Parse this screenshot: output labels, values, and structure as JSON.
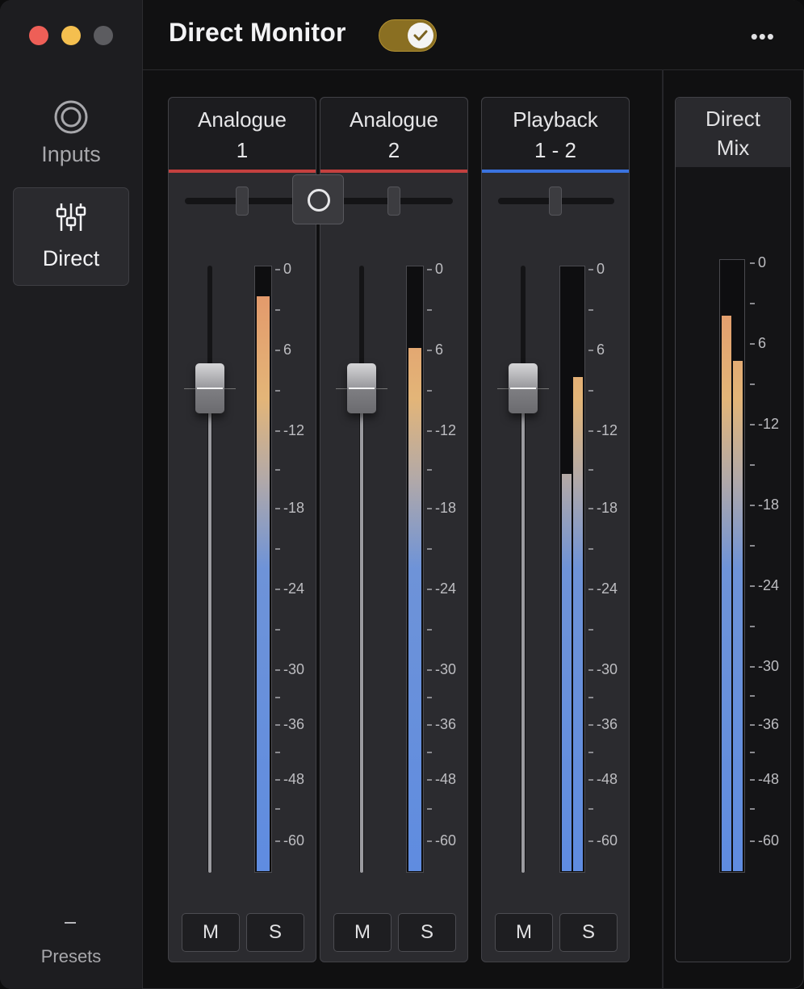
{
  "window": {
    "title": "Direct Monitor",
    "direct_monitor_enabled": true
  },
  "sidebar": {
    "items": [
      {
        "label": "Inputs",
        "icon": "inputs-icon",
        "selected": false
      },
      {
        "label": "Direct",
        "icon": "mixer-sliders-icon",
        "selected": true
      }
    ],
    "presets_label": "Presets"
  },
  "header": {
    "more_icon": "ellipsis-icon",
    "more_label": "•••"
  },
  "channels": [
    {
      "name_line1": "Analogue",
      "name_line2": "1",
      "strip_color": "#c4403f",
      "pan": 0.5,
      "fader_level": 0.2,
      "meters": [
        0.96
      ],
      "mute_label": "M",
      "solo_label": "S"
    },
    {
      "name_line1": "Analogue",
      "name_line2": "2",
      "strip_color": "#c4403f",
      "pan": 0.5,
      "fader_level": 0.2,
      "meters": [
        0.87
      ],
      "mute_label": "M",
      "solo_label": "S"
    },
    {
      "name_line1": "Playback",
      "name_line2": "1 - 2",
      "strip_color": "#3a73e0",
      "pan": 0.5,
      "fader_level": 0.2,
      "meters": [
        0.66,
        0.82
      ],
      "mute_label": "M",
      "solo_label": "S"
    }
  ],
  "stereo_link_icon": "link-circle-icon",
  "mix": {
    "name_line1": "Direct",
    "name_line2": "Mix",
    "meters": [
      0.91,
      0.84
    ]
  },
  "scale_labels": [
    "0",
    "6",
    "12",
    "18",
    "24",
    "30",
    "36",
    "48",
    "60"
  ],
  "scale_text": {
    "t0": "0",
    "t6": "6",
    "t12": "-12",
    "t18": "-18",
    "t24": "-24",
    "t30": "-30",
    "t36": "-36",
    "t48": "-48",
    "t60": "-60"
  },
  "colors": {
    "accent_toggle": "#8a6f22",
    "meter_blue": "#5f8ce0",
    "meter_orange": "#e39268",
    "analogue_strip": "#c4403f",
    "playback_strip": "#3a73e0"
  }
}
